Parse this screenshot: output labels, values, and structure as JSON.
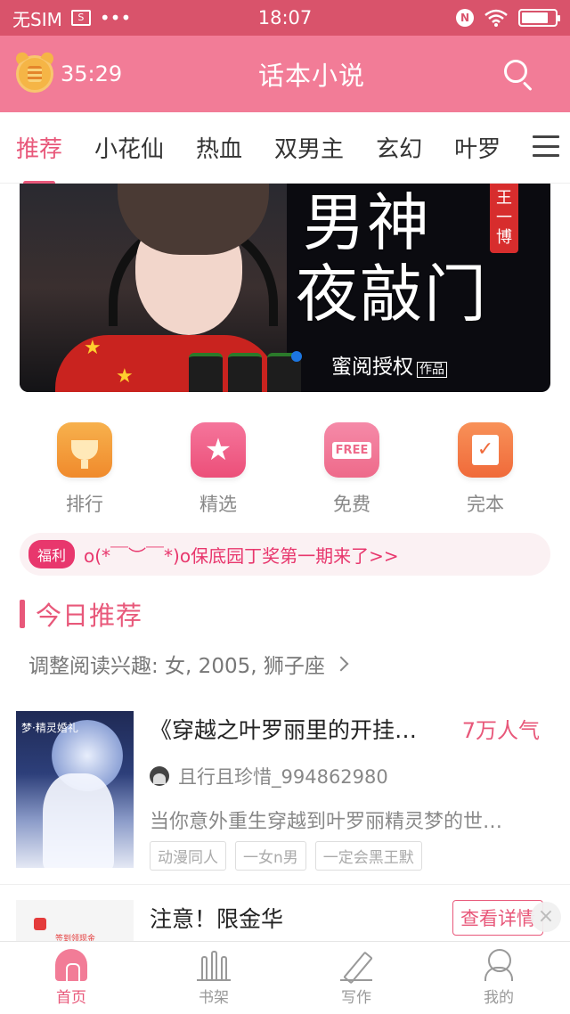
{
  "status_bar": {
    "carrier": "无SIM",
    "dots": "•••",
    "time": "18:07",
    "nfc": "N"
  },
  "header": {
    "timer": "35:29",
    "title": "话本小说",
    "accent": "#f27c97"
  },
  "tabs": [
    {
      "label": "推荐",
      "active": true
    },
    {
      "label": "小花仙"
    },
    {
      "label": "热血"
    },
    {
      "label": "双男主"
    },
    {
      "label": "玄幻"
    },
    {
      "label": "叶罗"
    }
  ],
  "banner": {
    "title_line1": "男神",
    "title_line2": "夜敲门",
    "tag": "王一博",
    "subtitle": "蜜阅授权",
    "subtitle_tag": "作品"
  },
  "categories": [
    {
      "label": "排行",
      "icon": "trophy-icon"
    },
    {
      "label": "精选",
      "icon": "star-icon"
    },
    {
      "label": "免费",
      "icon": "free-icon",
      "icon_text": "FREE"
    },
    {
      "label": "完本",
      "icon": "check-book-icon"
    }
  ],
  "notice": {
    "badge": "福利",
    "text": "o(*￣︶￣*)o保底园丁奖第一期来了>>"
  },
  "section": {
    "title": "今日推荐",
    "interest": "调整阅读兴趣: 女, 2005, 狮子座"
  },
  "book": {
    "cover_text": "梦·精灵婚礼",
    "title": "《穿越之叶罗丽里的开挂…",
    "popularity": "7万人气",
    "author": "且行且珍惜_994862980",
    "description": "当你意外重生穿越到叶罗丽精灵梦的世…",
    "tags": [
      "动漫同人",
      "一女n男",
      "一定会黑王默"
    ]
  },
  "ad": {
    "thumb_text": "签到领现金",
    "title": "注意！限金华",
    "detail_button": "查看详情",
    "close": "×"
  },
  "bottom_nav": [
    {
      "label": "首页",
      "icon": "home-icon",
      "active": true
    },
    {
      "label": "书架",
      "icon": "bookshelf-icon"
    },
    {
      "label": "写作",
      "icon": "pen-icon"
    },
    {
      "label": "我的",
      "icon": "profile-icon"
    }
  ]
}
